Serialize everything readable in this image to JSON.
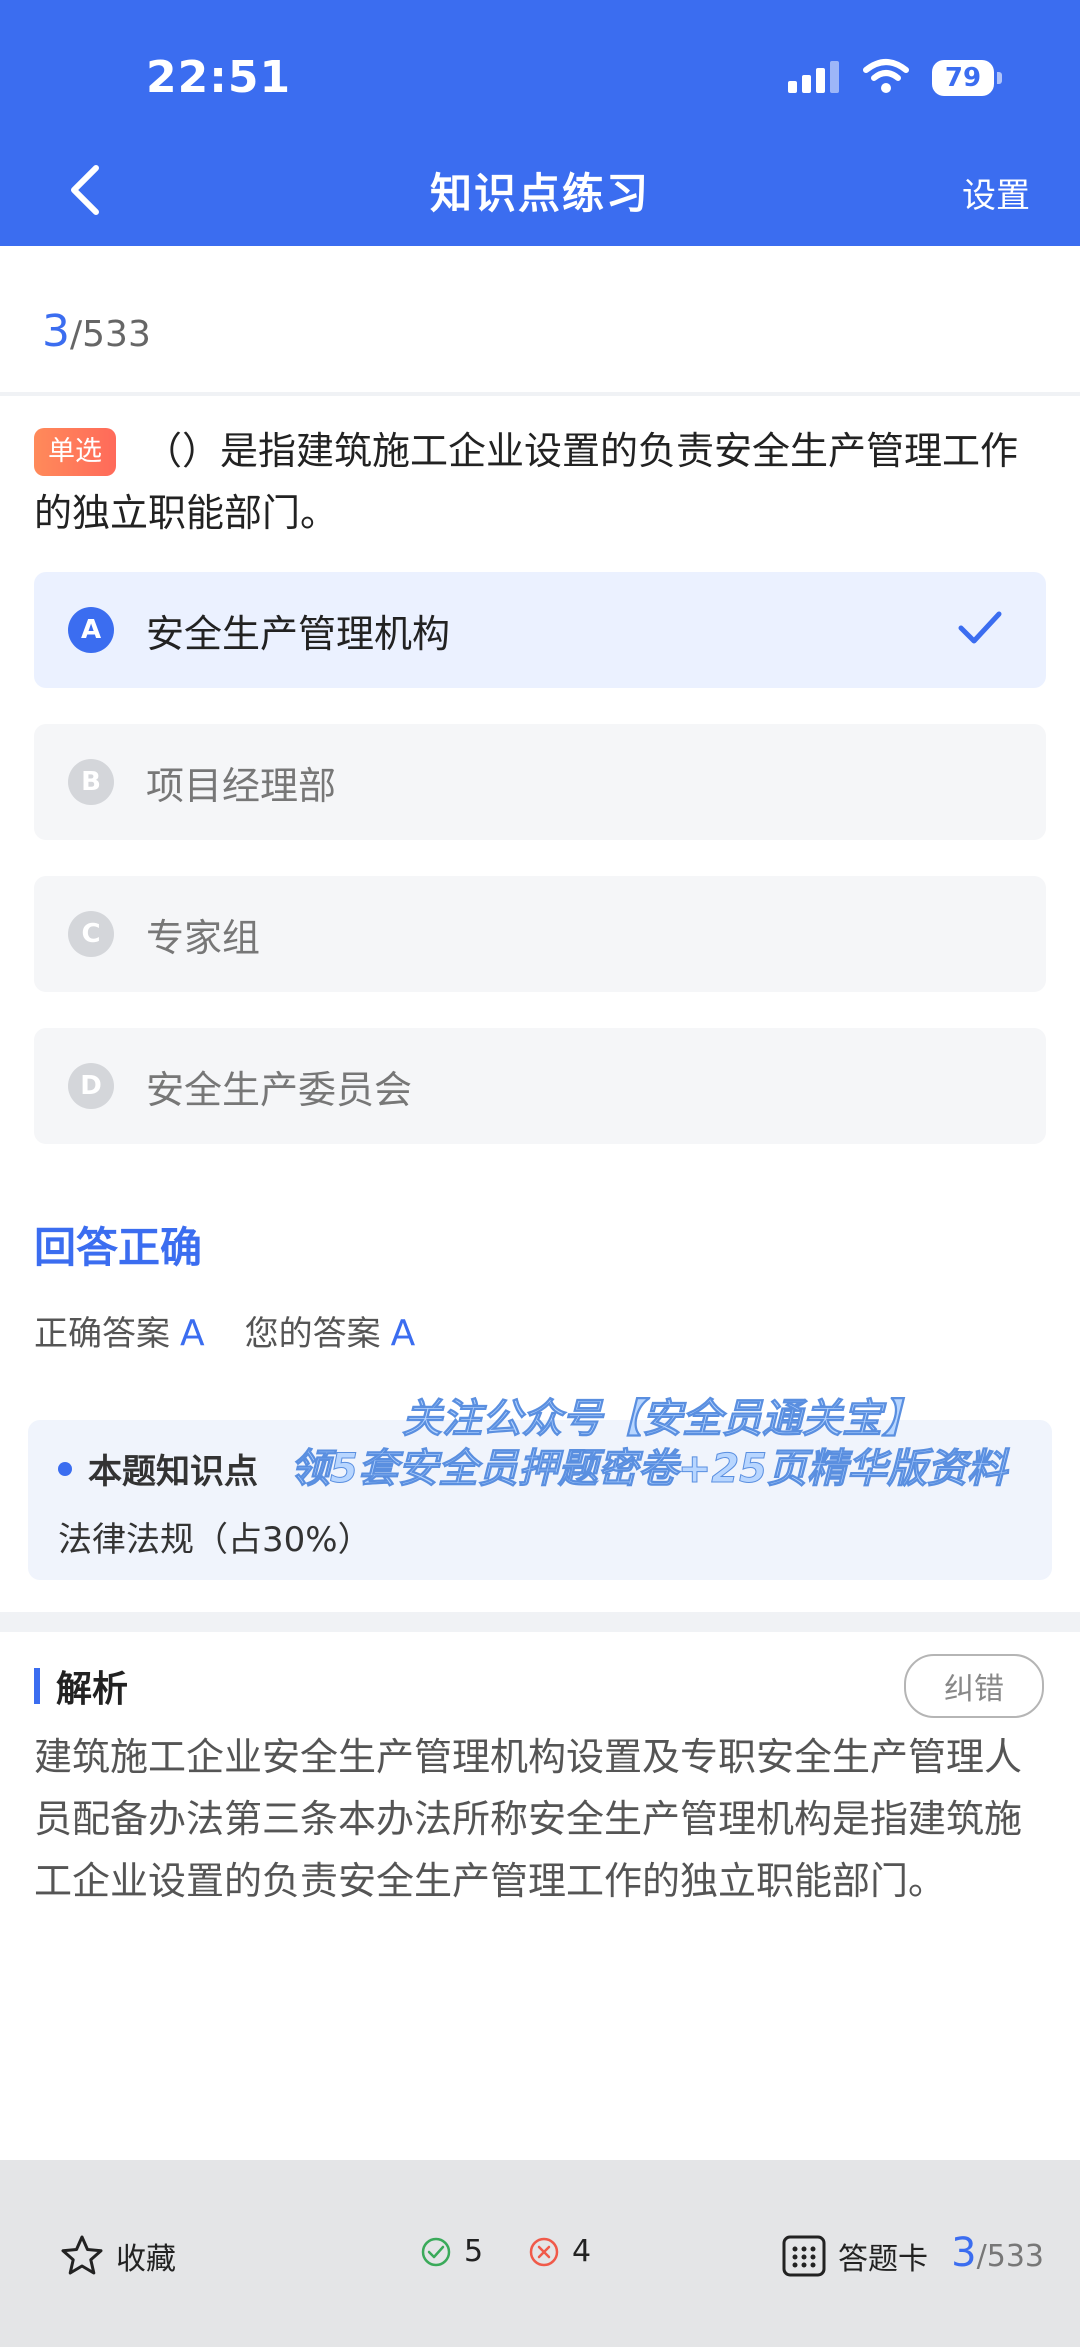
{
  "status": {
    "time": "22:51",
    "battery": "79"
  },
  "nav": {
    "title": "知识点练习",
    "settings": "设置"
  },
  "progress": {
    "current": "3",
    "total": "/533"
  },
  "question": {
    "type_badge": "单选",
    "text": "（）是指建筑施工企业设置的负责安全生产管理工作的独立职能部门。"
  },
  "options": [
    {
      "letter": "A",
      "text": "安全生产管理机构",
      "selected": true
    },
    {
      "letter": "B",
      "text": "项目经理部",
      "selected": false
    },
    {
      "letter": "C",
      "text": "专家组",
      "selected": false
    },
    {
      "letter": "D",
      "text": "安全生产委员会",
      "selected": false
    }
  ],
  "result": {
    "title": "回答正确",
    "correct_label": "正确答案",
    "correct_value": "A",
    "your_label": "您的答案",
    "your_value": "A"
  },
  "knowledge": {
    "heading": "本题知识点",
    "content": "法律法规（占30%）"
  },
  "watermark": {
    "line1": "关注公众号【安全员通关宝】",
    "line2": "领5套安全员押题密卷+25页精华版资料"
  },
  "analysis": {
    "title": "解析",
    "report_button": "纠错",
    "text": "建筑施工企业安全生产管理机构设置及专职安全生产管理人员配备办法第三条本办法所称安全生产管理机构是指建筑施工企业设置的负责安全生产管理工作的独立职能部门。"
  },
  "bottom_bar": {
    "favorite": "收藏",
    "correct_count": "5",
    "wrong_count": "4",
    "answer_card": "答题卡",
    "page_current": "3",
    "page_total": "/533"
  },
  "colors": {
    "primary": "#3b6df0",
    "badge": "#ff7a5a",
    "correct": "#3aaa5a",
    "wrong": "#f05a4a"
  }
}
